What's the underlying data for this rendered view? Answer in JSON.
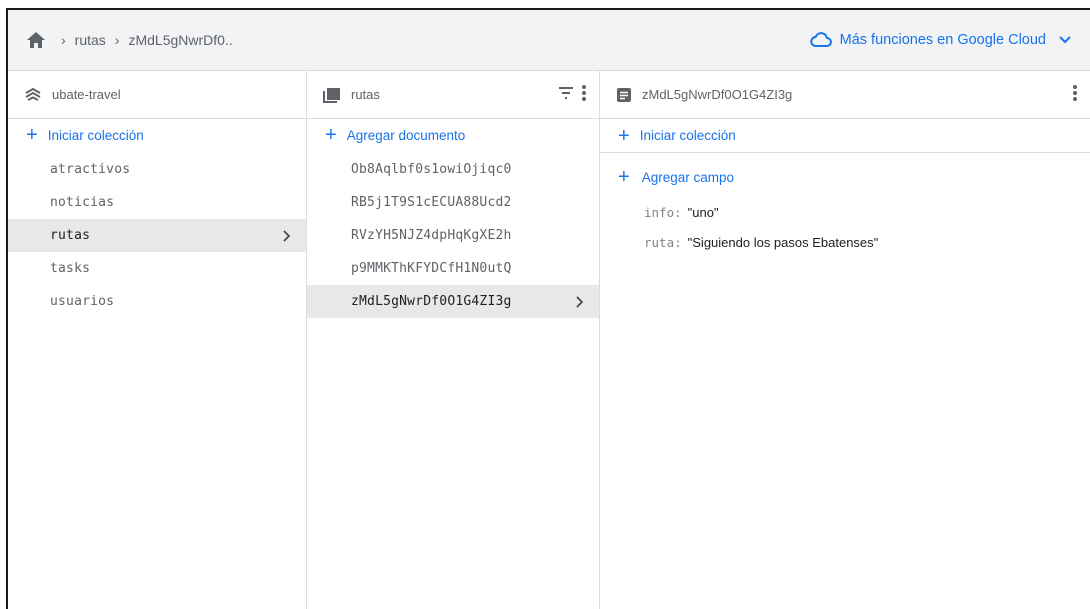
{
  "colors": {
    "accent": "#1a73e8",
    "selected_bg": "#e8e8e8",
    "topbar_bg": "#f1f3f4"
  },
  "breadcrumb": {
    "home_icon": "home-icon",
    "items": [
      "rutas",
      "zMdL5gNwrDf0.."
    ]
  },
  "cloud_link": {
    "label": "Más funciones en Google Cloud",
    "icon": "cloud-icon"
  },
  "panels": {
    "root": {
      "title": "ubate-travel",
      "add_label": "Iniciar colección",
      "items": [
        "atractivos",
        "noticias",
        "rutas",
        "tasks",
        "usuarios"
      ],
      "selected": "rutas"
    },
    "collection": {
      "title": "rutas",
      "add_label": "Agregar documento",
      "items": [
        "Ob8Aqlbf0s1owiOjiqc0",
        "RB5j1T9S1cECUA88Ucd2",
        "RVzYH5NJZ4dpHqKgXE2h",
        "p9MMKThKFYDCfH1N0utQ",
        "zMdL5gNwrDf0O1G4ZI3g"
      ],
      "selected": "zMdL5gNwrDf0O1G4ZI3g"
    },
    "document": {
      "title": "zMdL5gNwrDf0O1G4ZI3g",
      "add_collection_label": "Iniciar colección",
      "add_field_label": "Agregar campo",
      "fields": [
        {
          "key": "info",
          "value": "\"uno\""
        },
        {
          "key": "ruta",
          "value": "\"Siguiendo los pasos Ebatenses\""
        }
      ]
    }
  }
}
